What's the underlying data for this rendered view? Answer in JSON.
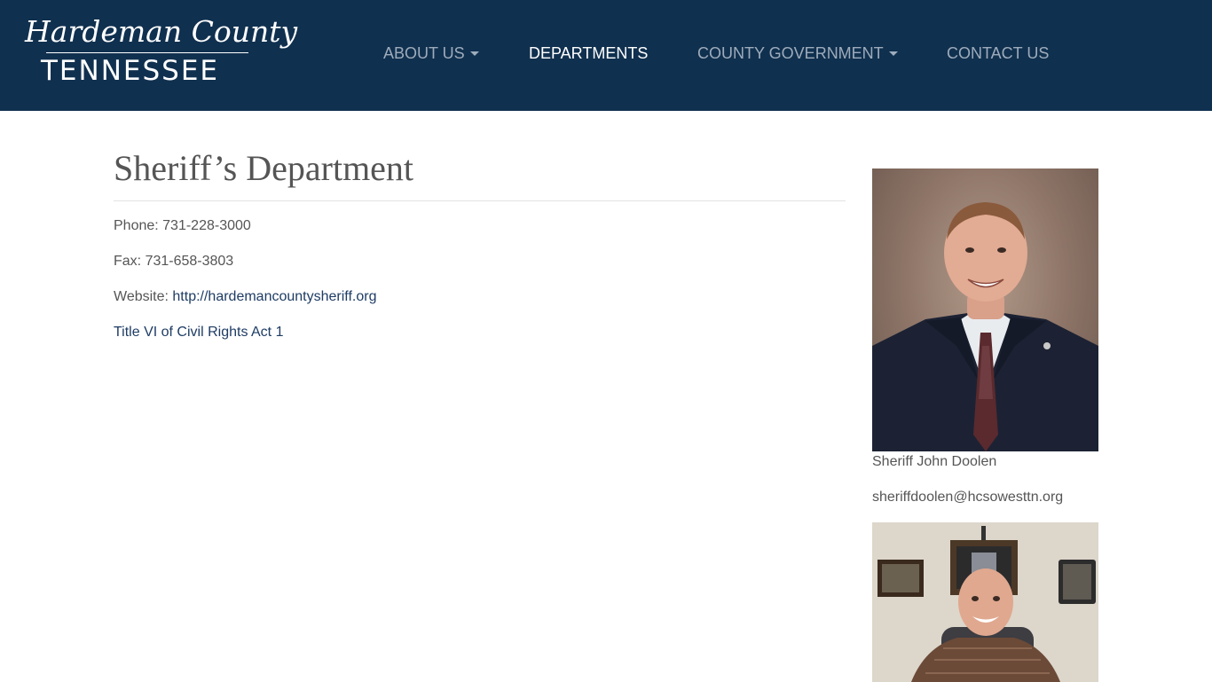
{
  "header": {
    "logo_script": "Hardeman County",
    "logo_state": "TENNESSEE",
    "nav": [
      {
        "label": "ABOUT US",
        "dropdown": true,
        "active": false
      },
      {
        "label": "DEPARTMENTS",
        "dropdown": false,
        "active": true
      },
      {
        "label": "COUNTY GOVERNMENT",
        "dropdown": true,
        "active": false
      },
      {
        "label": "CONTACT US",
        "dropdown": false,
        "active": false
      }
    ]
  },
  "page": {
    "title": "Sheriff’s Department",
    "phone_label": "Phone: 731-228-3000",
    "fax_label": "Fax: 731-658-3803",
    "website_prefix": "Website: ",
    "website_url": "http://hardemancountysheriff.org",
    "title_vi_link": "Title VI of Civil Rights Act 1"
  },
  "sidebar": {
    "sheriff_name": "Sheriff John Doolen",
    "sheriff_email": "sheriffdoolen@hcsowesttn.org"
  },
  "colors": {
    "header_bg": "#10304f",
    "nav_text": "#9eacbb",
    "nav_active": "#ffffff",
    "link": "#1e3c64",
    "body_text": "#555555"
  }
}
